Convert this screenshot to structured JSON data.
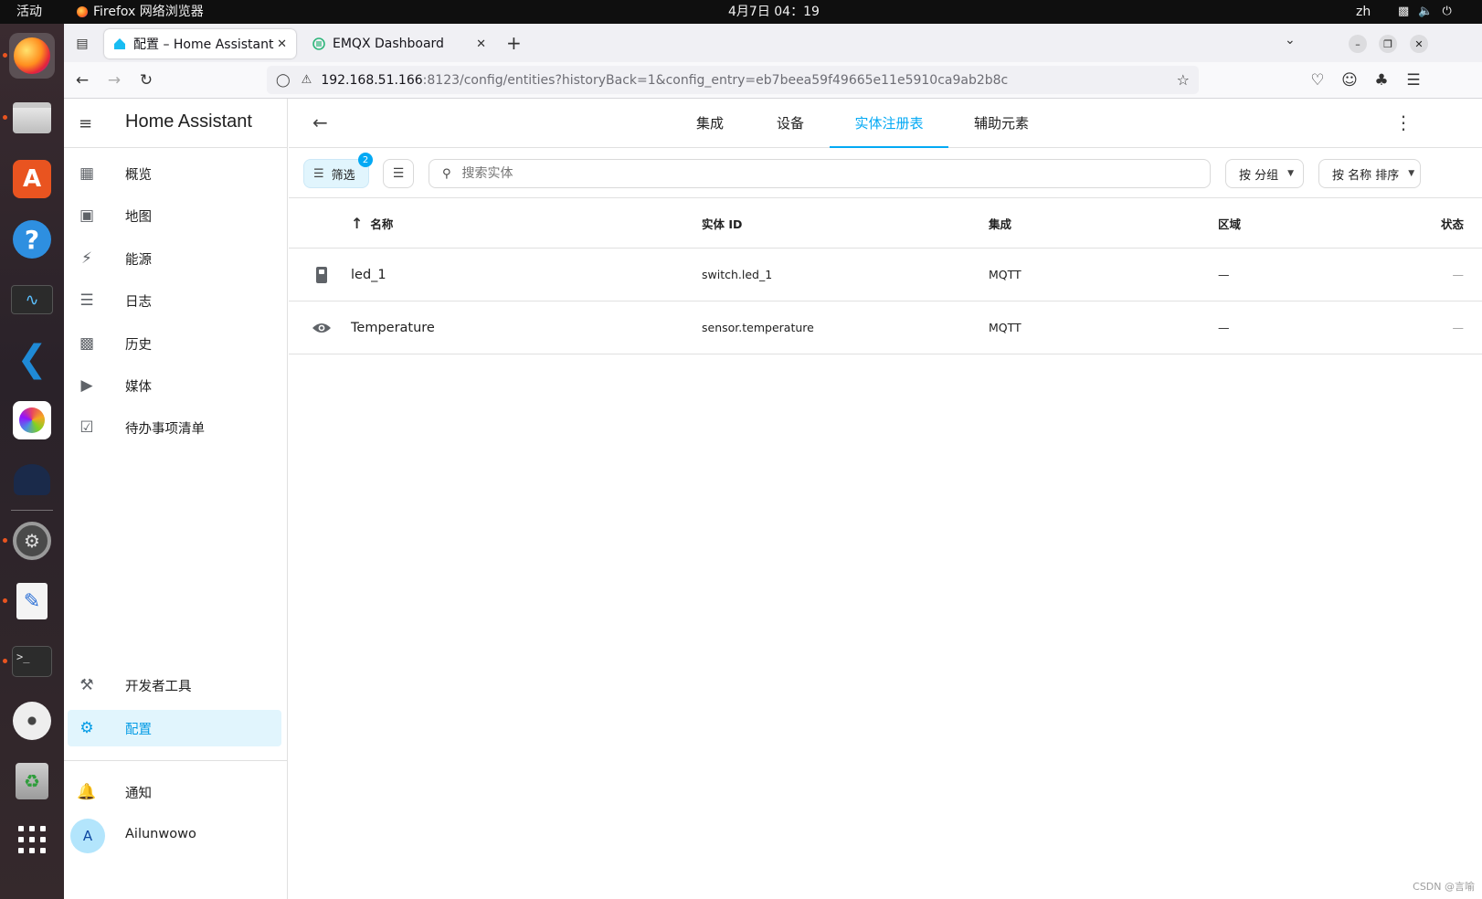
{
  "system": {
    "activities": "活动",
    "app_name": "Firefox 网络浏览器",
    "clock": "4月7日  04：19",
    "lang": "zh"
  },
  "browser": {
    "tabs": [
      {
        "title": "配置 – Home Assistant",
        "active": true
      },
      {
        "title": "EMQX Dashboard",
        "active": false
      }
    ],
    "url_host": "192.168.51.166",
    "url_rest": ":8123/config/entities?historyBack=1&config_entry=eb7beea59f49665e11e5910ca9ab2b8c"
  },
  "sidebar": {
    "title": "Home Assistant",
    "items": [
      {
        "label": "概览",
        "icon": "dashboard-icon"
      },
      {
        "label": "地图",
        "icon": "map-icon"
      },
      {
        "label": "能源",
        "icon": "lightning-icon"
      },
      {
        "label": "日志",
        "icon": "logbook-icon"
      },
      {
        "label": "历史",
        "icon": "history-icon"
      },
      {
        "label": "媒体",
        "icon": "media-icon"
      },
      {
        "label": "待办事项清单",
        "icon": "todo-icon"
      }
    ],
    "bottom_items": [
      {
        "label": "开发者工具",
        "icon": "hammer-icon"
      },
      {
        "label": "配置",
        "icon": "cog-icon",
        "active": true
      }
    ],
    "notifications": "通知",
    "user": {
      "initial": "A",
      "name": "Ailunwowo"
    }
  },
  "header": {
    "tabs": [
      {
        "label": "集成",
        "active": false
      },
      {
        "label": "设备",
        "active": false
      },
      {
        "label": "实体注册表",
        "active": true
      },
      {
        "label": "辅助元素",
        "active": false
      }
    ]
  },
  "toolbar": {
    "filter_label": "筛选",
    "filter_count": "2",
    "search_placeholder": "搜索实体",
    "group_label": "按 分组",
    "sort_label": "按 名称 排序"
  },
  "table": {
    "columns": {
      "name": "名称",
      "entity_id": "实体 ID",
      "integration": "集成",
      "area": "区域",
      "status": "状态"
    },
    "rows": [
      {
        "icon": "switch-icon",
        "name": "led_1",
        "entity_id": "switch.led_1",
        "integration": "MQTT",
        "area": "—",
        "status": "—"
      },
      {
        "icon": "eye-icon",
        "name": "Temperature",
        "entity_id": "sensor.temperature",
        "integration": "MQTT",
        "area": "—",
        "status": "—"
      }
    ]
  },
  "watermark": "CSDN @言喻",
  "colors": {
    "accent": "#03a9f4",
    "active_bg": "#e1f5fd",
    "topbar": "#0f0f0f"
  }
}
